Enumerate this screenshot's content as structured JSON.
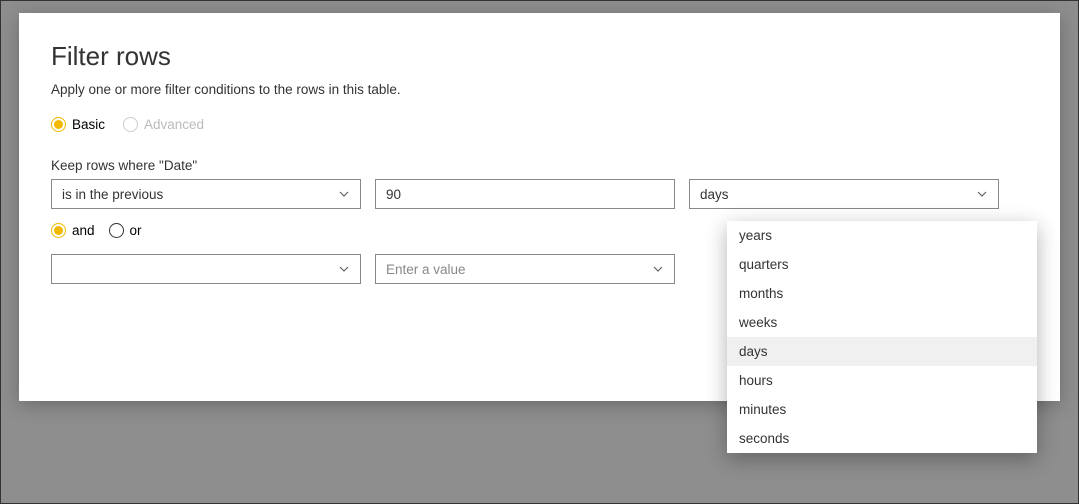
{
  "dialog": {
    "title": "Filter rows",
    "subtitle": "Apply one or more filter conditions to the rows in this table."
  },
  "mode": {
    "basic": "Basic",
    "advanced": "Advanced"
  },
  "keep_label": "Keep rows where \"Date\"",
  "row1": {
    "condition": "is in the previous",
    "value": "90",
    "unit_selected": "days"
  },
  "logic": {
    "and": "and",
    "or": "or"
  },
  "row2": {
    "condition": "",
    "value_placeholder": "Enter a value"
  },
  "unit_options": [
    "years",
    "quarters",
    "months",
    "weeks",
    "days",
    "hours",
    "minutes",
    "seconds"
  ],
  "unit_highlight": "days"
}
